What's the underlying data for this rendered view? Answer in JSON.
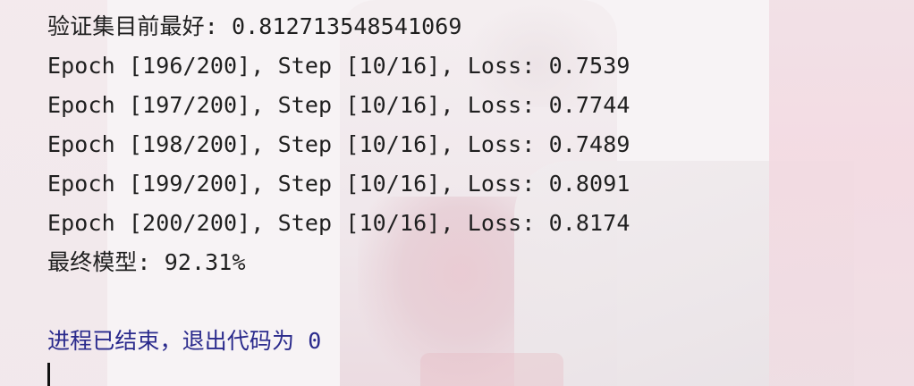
{
  "console": {
    "lines": [
      "验证集目前最好: 0.812713548541069",
      "Epoch [196/200], Step [10/16], Loss: 0.7539",
      "Epoch [197/200], Step [10/16], Loss: 0.7744",
      "Epoch [198/200], Step [10/16], Loss: 0.7489",
      "Epoch [199/200], Step [10/16], Loss: 0.8091",
      "Epoch [200/200], Step [10/16], Loss: 0.8174",
      "最终模型: 92.31%"
    ],
    "exit_message": "进程已结束，退出代码为 0"
  },
  "colors": {
    "text": "#1f1f1f",
    "exit_text": "#2a2a8c",
    "background": "#f7f3f5"
  }
}
